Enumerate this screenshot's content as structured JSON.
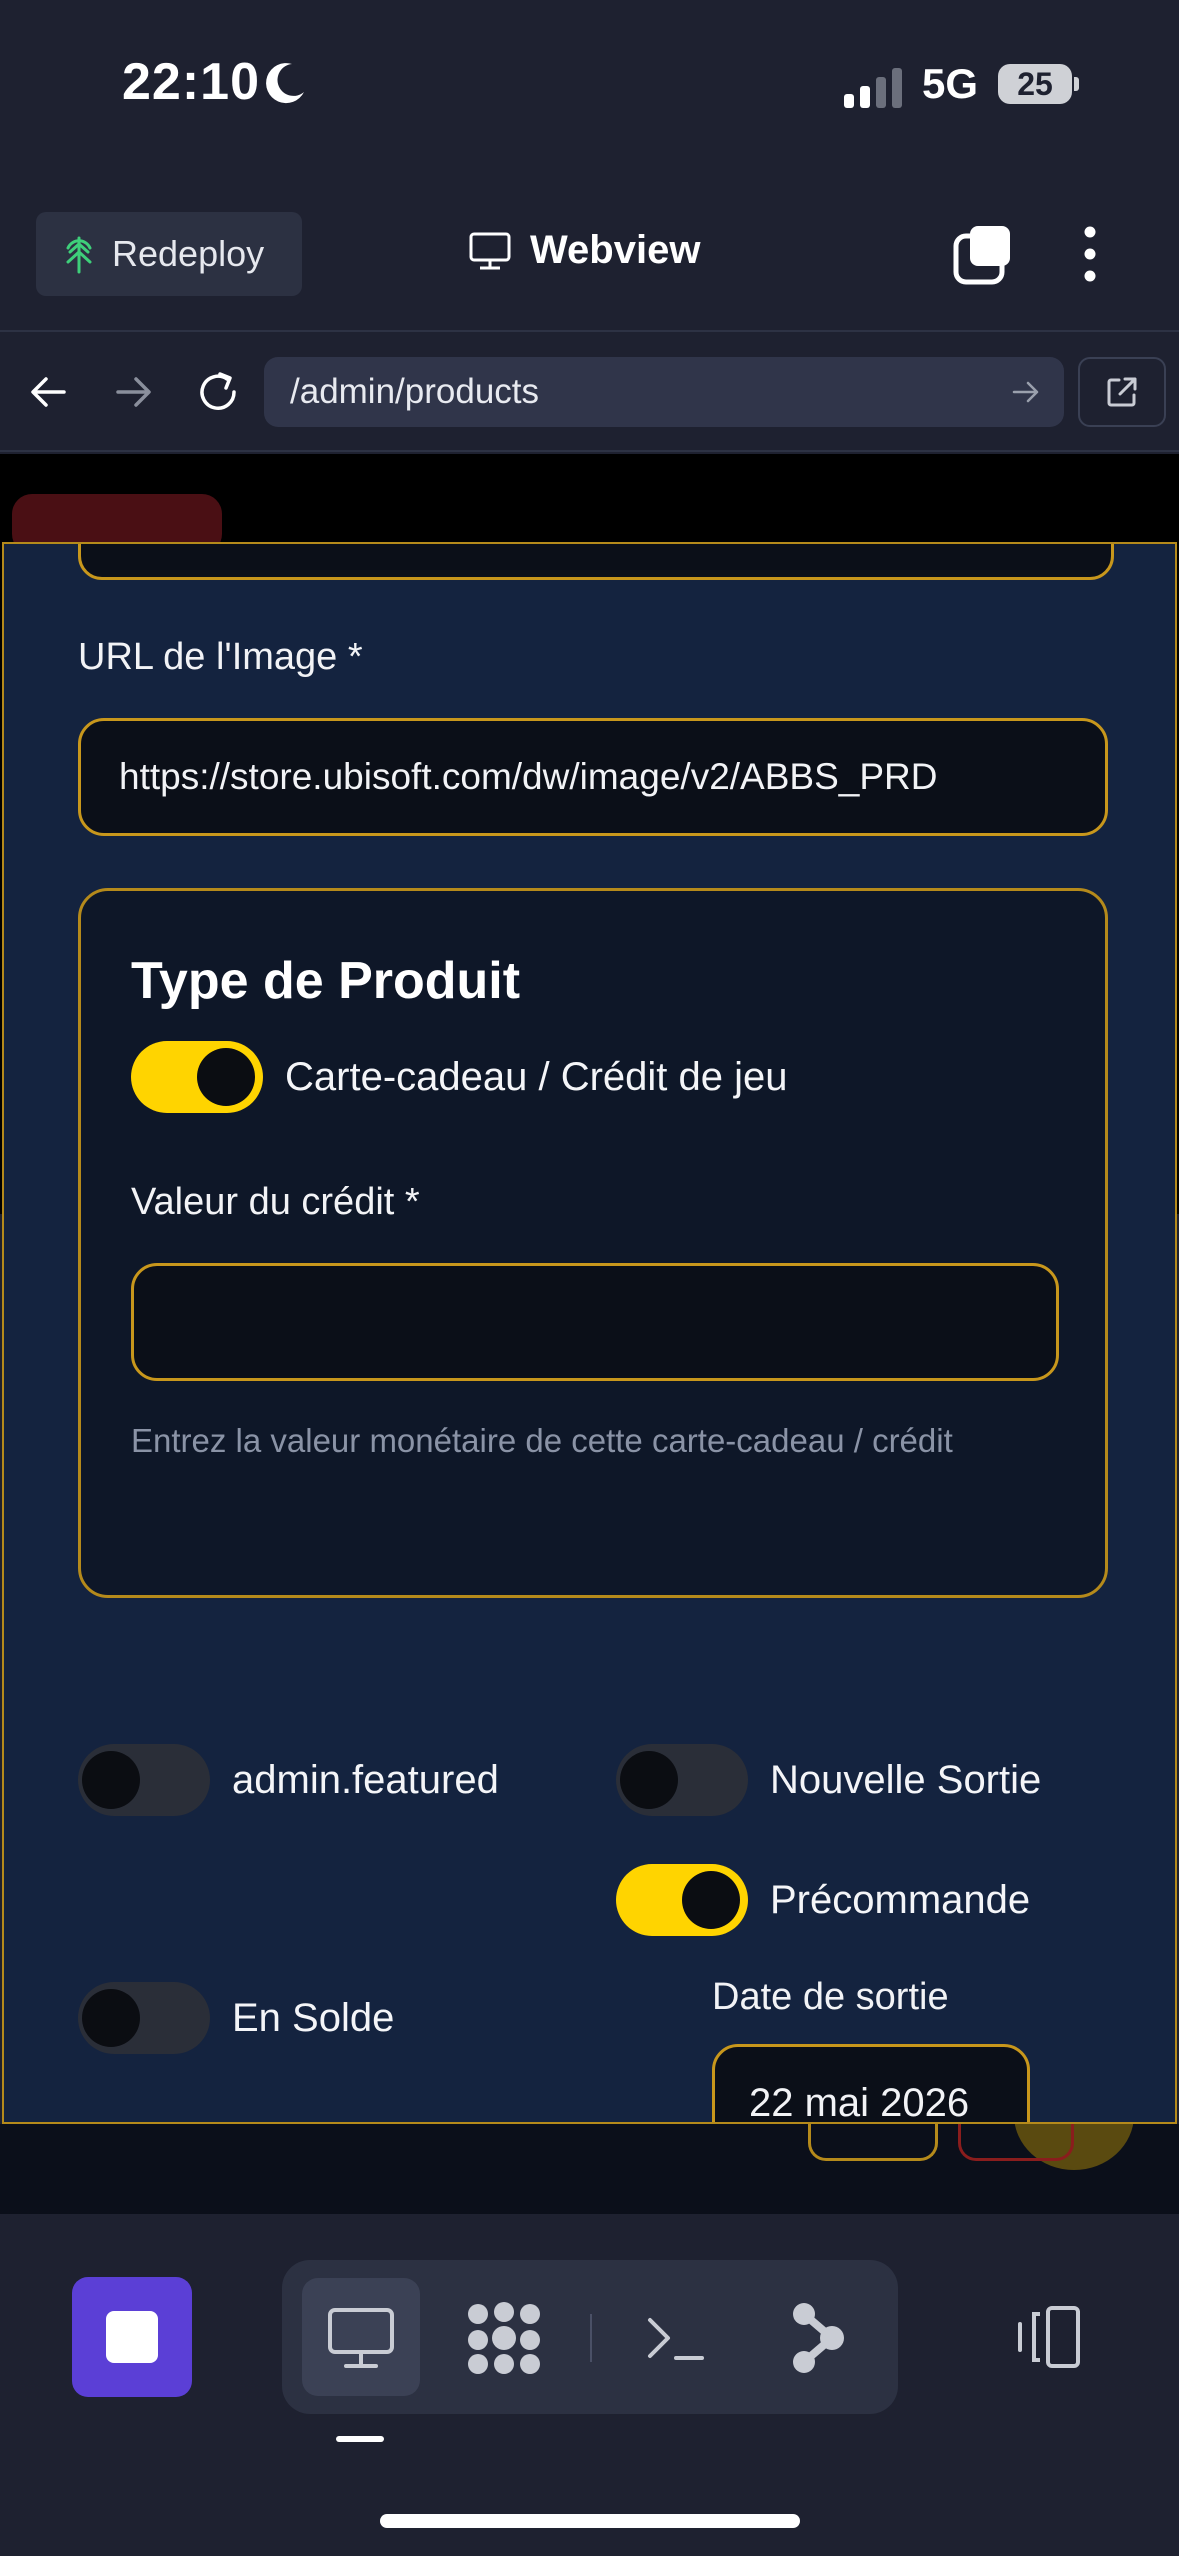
{
  "status_bar": {
    "time": "22:10",
    "network": "5G",
    "battery": "25"
  },
  "header": {
    "redeploy_label": "Redeploy",
    "title": "Webview"
  },
  "url_bar": {
    "url": "/admin/products"
  },
  "form": {
    "image_url_label": "URL de l'Image *",
    "image_url_value": "https://store.ubisoft.com/dw/image/v2/ABBS_PRD",
    "product_type": {
      "title": "Type de Produit",
      "gift_card_toggle": {
        "label": "Carte-cadeau / Crédit de jeu",
        "on": true
      },
      "credit_value_label": "Valeur du crédit *",
      "credit_value": "",
      "help_text": "Entrez la valeur monétaire de cette carte-cadeau / crédit"
    },
    "toggles": {
      "featured": {
        "label": "admin.featured",
        "on": false
      },
      "new_release": {
        "label": "Nouvelle Sortie",
        "on": false
      },
      "preorder": {
        "label": "Précommande",
        "on": true
      },
      "on_sale": {
        "label": "En Solde",
        "on": false
      }
    },
    "release_date_label": "Date de sortie",
    "release_date_value": "22 mai 2026"
  },
  "colors": {
    "accent_yellow": "#ffd400",
    "field_border": "#c8971c",
    "modal_bg": "#14233f",
    "stop_button": "#5b3fd6"
  },
  "toolbar": {
    "icons": [
      "stop-icon",
      "desktop-icon",
      "nodes-icon",
      "terminal-icon",
      "git-branch-icon",
      "device-switch-icon"
    ]
  }
}
